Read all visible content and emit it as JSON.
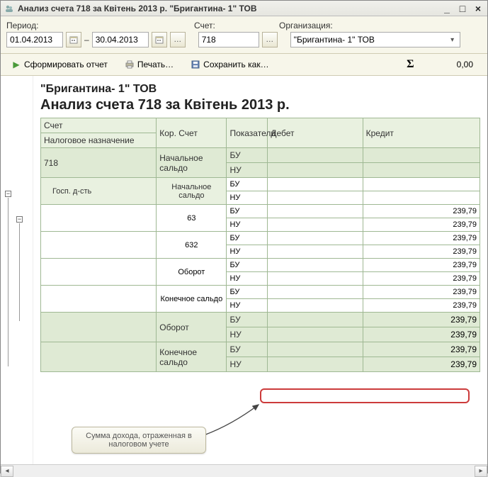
{
  "window": {
    "title": "Анализ счета 718 за Квітень 2013 р. \"Бригантина- 1\" ТОВ"
  },
  "labels": {
    "period": "Период:",
    "account": "Счет:",
    "org": "Организация:"
  },
  "inputs": {
    "date_from": "01.04.2013",
    "date_to": "30.04.2013",
    "account": "718",
    "org": "\"Бригантина- 1\" ТОВ"
  },
  "toolbar": {
    "form": "Сформировать отчет",
    "print": "Печать…",
    "save": "Сохранить как…",
    "sum_value": "0,00"
  },
  "report": {
    "org_line": "\"Бригантина- 1\" ТОВ",
    "title": "Анализ счета 718 за Квітень 2013 р.",
    "headers": {
      "acct": "Счет",
      "kor": "Кор. Счет",
      "ind": "Показатели",
      "debit": "Дебет",
      "credit": "Кредит",
      "tax": "Налоговое назначение"
    },
    "labels": {
      "acct718": "718",
      "start_bal": "Начальное сальдо",
      "gosp": "Госп. д-сть",
      "start_bal_s": "Начальное сальдо",
      "k63": "63",
      "k632": "632",
      "oborot_s": "Оборот",
      "end_bal_s": "Конечное сальдо",
      "oborot": "Оборот",
      "end_bal": "Конечное сальдо",
      "bu": "БУ",
      "nu": "НУ"
    },
    "values": {
      "v": "239,79"
    }
  },
  "callout": {
    "text": "Сумма дохода, отраженная в налоговом учете"
  }
}
